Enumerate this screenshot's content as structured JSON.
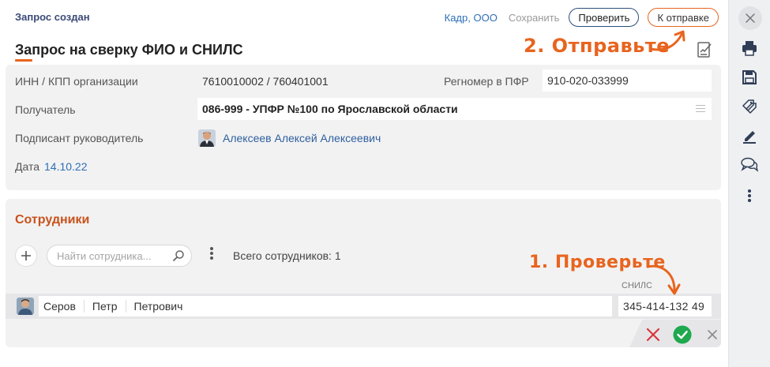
{
  "header": {
    "status": "Запрос создан",
    "org": "Кадр, ООО",
    "save_label": "Сохранить",
    "check_label": "Проверить",
    "send_label": "К отправке"
  },
  "title": "Запрос на сверку ФИО и СНИЛС",
  "annotations": {
    "step2": "2. Отправьте",
    "step1": "1. Проверьте"
  },
  "info": {
    "inn_label": "ИНН / КПП организации",
    "inn_value": "7610010002 / 760401001",
    "regnum_label": "Регномер в ПФР",
    "regnum_value": "910-020-033999",
    "recipient_label": "Получатель",
    "recipient_value": "086-999 - УПФР №100 по Ярославской области",
    "signer_label": "Подписант руководитель",
    "signer_value": "Алексеев Алексей Алексеевич",
    "date_label": "Дата",
    "date_value": "14.10.22"
  },
  "employees": {
    "section_title": "Сотрудники",
    "search_placeholder": "Найти сотрудника...",
    "total": "Всего сотрудников: 1",
    "snils_header": "СНИЛС",
    "rows": [
      {
        "last": "Серов",
        "first": "Петр",
        "middle": "Петрович",
        "snils": "345-414-132 49"
      }
    ]
  },
  "colors": {
    "accent": "#e8641e",
    "link": "#2e6fb5",
    "panel": "#f2f2f3",
    "ok": "#1fa84f",
    "cancel": "#d9373b"
  },
  "rail_icons": [
    "close-icon",
    "printer-icon",
    "save-icon",
    "tags-icon",
    "sign-pen-icon",
    "chat-icon",
    "more-vertical-icon"
  ]
}
